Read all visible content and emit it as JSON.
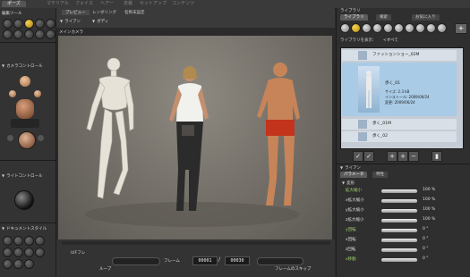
{
  "top_tabs": [
    "ポーズ",
    "マテリアル",
    "フェイス",
    "ヘアー",
    "衣装",
    "セットアップ",
    "コンテンツ"
  ],
  "left_panel": {
    "editing_tools_title": "編集ツール",
    "camera_controls_title": "カメラコントロール",
    "light_controls_title": "ライトコントロール",
    "document_style_title": "ドキュメントスタイル"
  },
  "viewport": {
    "tabs": [
      "プレビュー",
      "レンダリング",
      "名称未設定"
    ],
    "camera_label": "メインカメラ",
    "figure_select": "ライアン",
    "body_select": "ボディ",
    "frame_label": "フレーム",
    "current_frame": "00001",
    "total_frames": "00030",
    "loop_label": "ループ",
    "skip_frames_label": "フレームのスキップ",
    "keyframes_label": "UIFフレ"
  },
  "library": {
    "title": "ライブラリ",
    "tabs": [
      "ライブラリ",
      "検索",
      "お気に入り"
    ],
    "show_label": "ライブラリを表示:",
    "show_value": "<すべて",
    "items": [
      {
        "name": "ファッションショー_02M"
      },
      {
        "name": "歩く_01",
        "size": "サイズ: 2.3 kB",
        "installed": "インストール: 2009/06/24",
        "modified": "変更: 2009/06/24"
      },
      {
        "name": "歩く_01M"
      },
      {
        "name": "歩く_02"
      }
    ]
  },
  "params": {
    "figure_title": "ライアン",
    "tabs": [
      "パラメータ",
      "特性"
    ],
    "group_label": "変形",
    "rows": [
      {
        "label": "拡大縮小",
        "value": "100 %"
      },
      {
        "label": "x拡大縮小",
        "value": "100 %"
      },
      {
        "label": "y拡大縮小",
        "value": "100 %"
      },
      {
        "label": "z拡大縮小",
        "value": "100 %"
      },
      {
        "label": "y回転",
        "value": "0 °"
      },
      {
        "label": "x回転",
        "value": "0 °"
      },
      {
        "label": "z回転",
        "value": "0 °"
      },
      {
        "label": "x移動",
        "value": "0 °"
      }
    ]
  }
}
